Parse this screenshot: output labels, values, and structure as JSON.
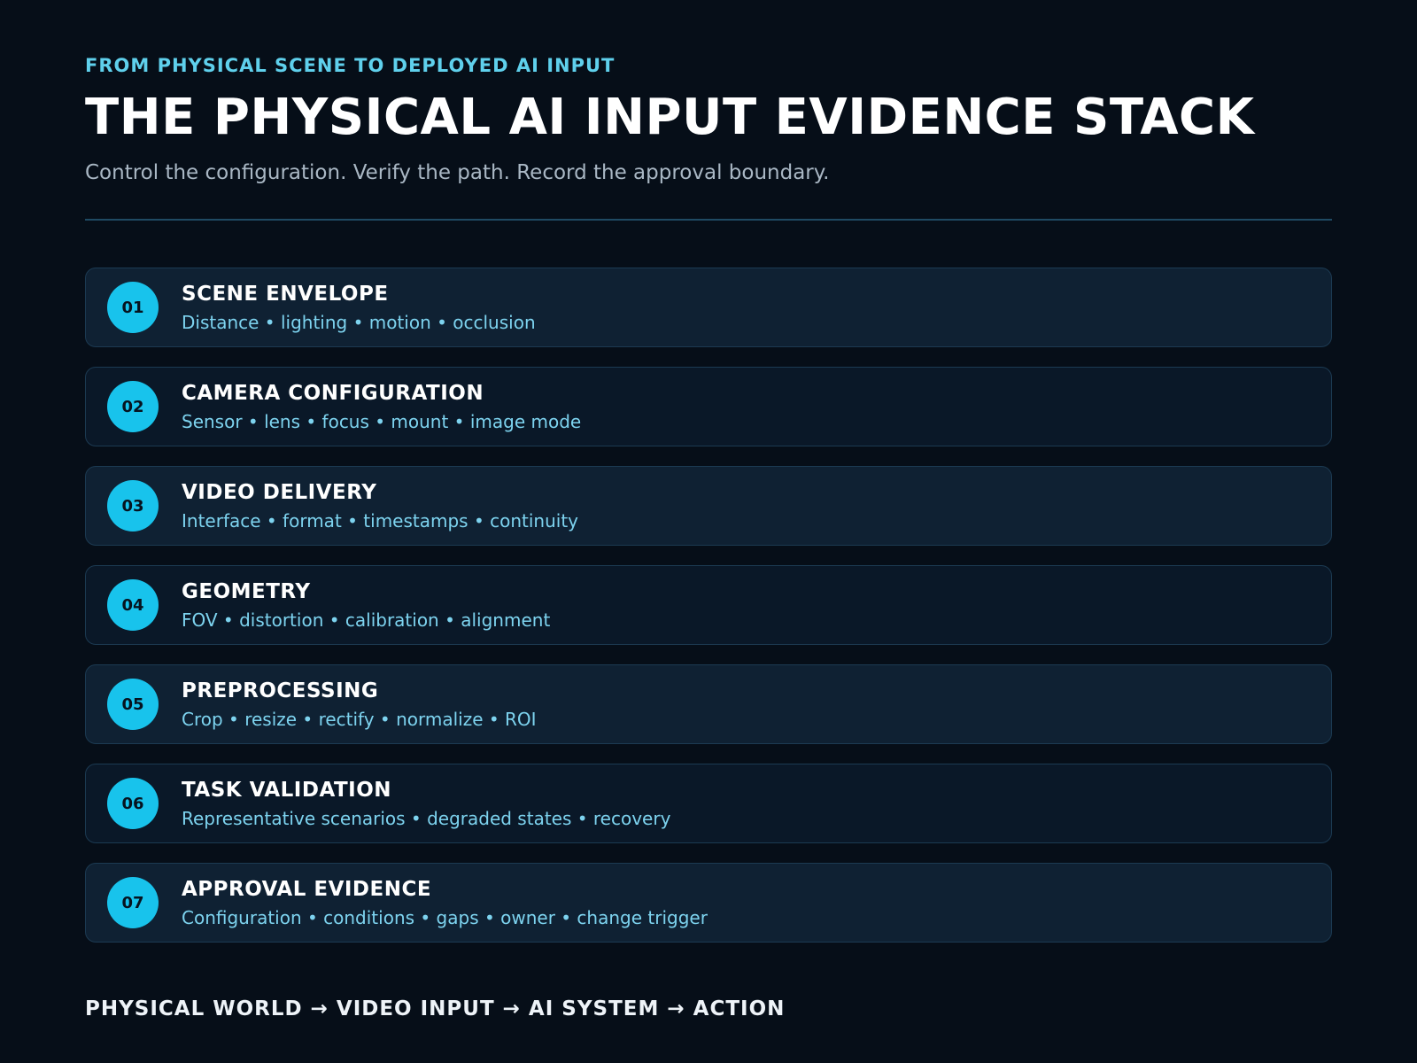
{
  "header": {
    "eyebrow": "FROM PHYSICAL SCENE TO DEPLOYED AI INPUT",
    "title": "THE PHYSICAL AI INPUT EVIDENCE STACK",
    "subtitle": "Control the configuration. Verify the path. Record the approval boundary."
  },
  "stack": {
    "layers": [
      {
        "number": "01",
        "title": "SCENE ENVELOPE",
        "detail": "Distance • lighting • motion • occlusion"
      },
      {
        "number": "02",
        "title": "CAMERA CONFIGURATION",
        "detail": "Sensor • lens • focus • mount • image mode"
      },
      {
        "number": "03",
        "title": "VIDEO DELIVERY",
        "detail": "Interface • format • timestamps • continuity"
      },
      {
        "number": "04",
        "title": "GEOMETRY",
        "detail": "FOV • distortion • calibration • alignment"
      },
      {
        "number": "05",
        "title": "PREPROCESSING",
        "detail": "Crop • resize • rectify • normalize • ROI"
      },
      {
        "number": "06",
        "title": "TASK VALIDATION",
        "detail": "Representative scenarios • degraded states • recovery"
      },
      {
        "number": "07",
        "title": "APPROVAL EVIDENCE",
        "detail": "Configuration • conditions • gaps • owner • change trigger"
      }
    ]
  },
  "footer": {
    "flow": "PHYSICAL WORLD → VIDEO INPUT → AI SYSTEM → ACTION"
  },
  "colors": {
    "background": "#060e18",
    "accent": "#18c3ec",
    "eyebrow": "#5fd0ec",
    "detail_text": "#7dd3ef",
    "card_border": "#1c3a52",
    "card_fill_light": "#0f2133",
    "card_fill_dark": "#0a1828"
  }
}
